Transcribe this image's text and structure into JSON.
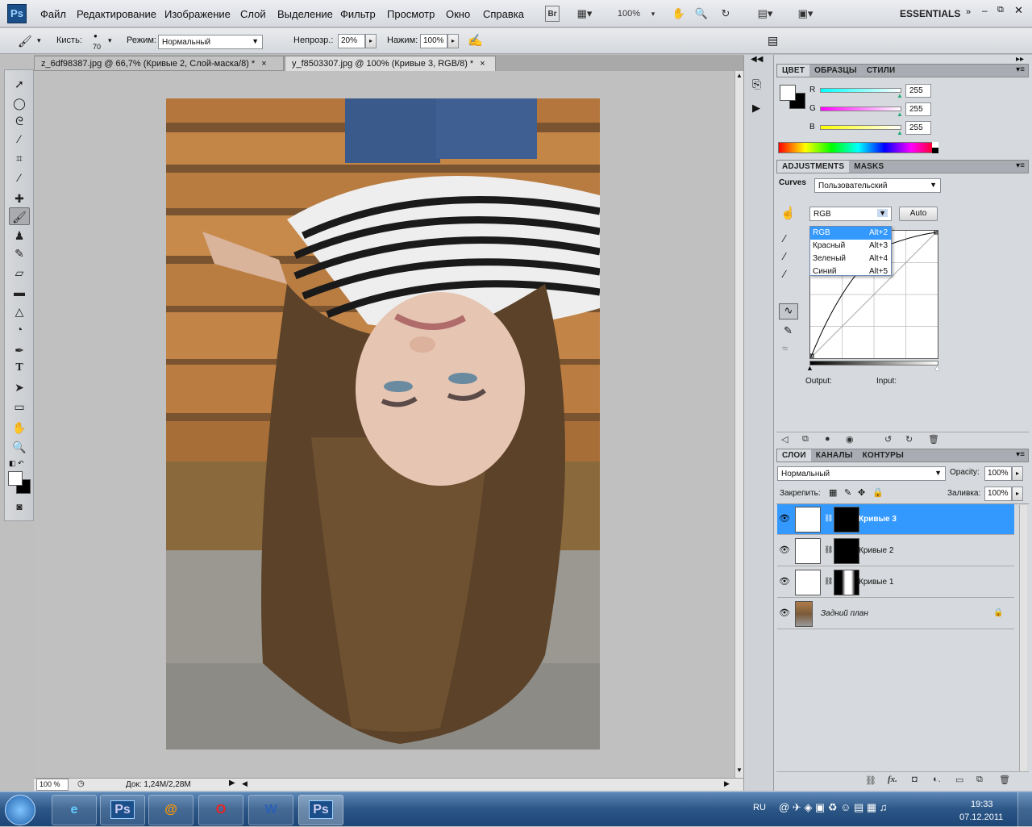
{
  "app": {
    "logo": "Ps"
  },
  "menu": [
    "Файл",
    "Редактирование",
    "Изображение",
    "Слой",
    "Выделение",
    "Фильтр",
    "Просмотр",
    "Окно",
    "Справка"
  ],
  "toolbar_top": {
    "br_label": "Br",
    "zoom": "100%",
    "workspace": "ESSENTIALS"
  },
  "options": {
    "brush_label": "Кисть:",
    "brush_size": "70",
    "mode_label": "Режим:",
    "mode_value": "Нормальный",
    "opacity_label": "Непрозр.:",
    "opacity_value": "20%",
    "flow_label": "Нажим:",
    "flow_value": "100%"
  },
  "doc_tabs": [
    {
      "label": "z_6df98387.jpg @ 66,7% (Кривые 2, Слой-маска/8) *",
      "active": false
    },
    {
      "label": "y_f8503307.jpg @ 100% (Кривые 3, RGB/8) *",
      "active": true
    }
  ],
  "status": {
    "zoom": "100 %",
    "doc": "Док: 1,24М/2,28М"
  },
  "color_panel": {
    "tabs": [
      "ЦВЕТ",
      "ОБРАЗЦЫ",
      "СТИЛИ"
    ],
    "r_label": "R",
    "g_label": "G",
    "b_label": "B",
    "r": "255",
    "g": "255",
    "b": "255"
  },
  "adjustments": {
    "tabs": [
      "ADJUSTMENTS",
      "MASKS"
    ],
    "title": "Curves",
    "preset": "Пользовательский",
    "channel": "RGB",
    "auto_label": "Auto",
    "output_label": "Output:",
    "input_label": "Input:",
    "channel_menu": [
      {
        "label": "RGB",
        "shortcut": "Alt+2"
      },
      {
        "label": "Красный",
        "shortcut": "Alt+3"
      },
      {
        "label": "Зеленый",
        "shortcut": "Alt+4"
      },
      {
        "label": "Синий",
        "shortcut": "Alt+5"
      }
    ]
  },
  "layers_panel": {
    "tabs": [
      "СЛОИ",
      "КАНАЛЫ",
      "КОНТУРЫ"
    ],
    "blend": "Нормальный",
    "opacity_label": "Opacity:",
    "opacity": "100%",
    "lock_label": "Закрепить:",
    "fill_label": "Заливка:",
    "fill": "100%",
    "layers": [
      {
        "name": "Кривые 3",
        "selected": true
      },
      {
        "name": "Кривые 2",
        "selected": false
      },
      {
        "name": "Кривые 1",
        "selected": false
      },
      {
        "name": "Задний план",
        "selected": false
      }
    ]
  },
  "taskbar": {
    "lang": "RU",
    "time": "19:33",
    "date": "07.12.2011",
    "ps_label": "Ps",
    "ps2_label": "Ps"
  },
  "colors": {
    "accent": "#3399ff",
    "photo_bg": "#6b4a2a"
  }
}
